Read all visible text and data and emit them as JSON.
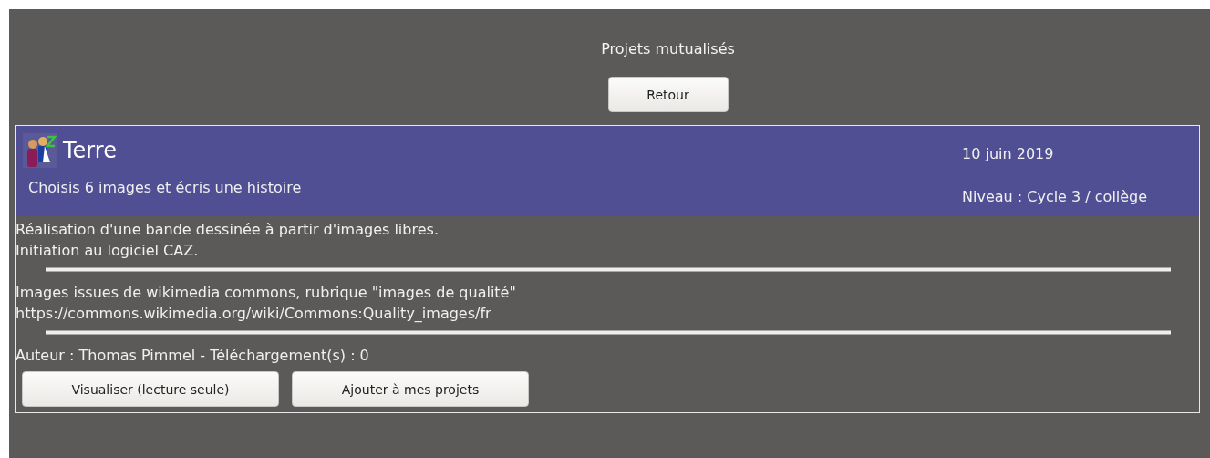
{
  "page": {
    "title": "Projets mutualisés",
    "back_button": "Retour"
  },
  "project": {
    "title": "Terre",
    "subtitle": "Choisis 6 images et écris une histoire",
    "date": "10 juin 2019",
    "level_label": "Niveau : Cycle 3 / collège",
    "sections": [
      {
        "lines": [
          "Réalisation d'une bande dessinée à partir d'images libres.",
          "Initiation au logiciel CAZ."
        ]
      },
      {
        "lines": [
          "Images issues de wikimedia commons, rubrique \"images de qualité\"",
          "https://commons.wikimedia.org/wiki/Commons:Quality_images/fr"
        ]
      }
    ],
    "meta": "Auteur : Thomas Pimmel - Téléchargement(s) : 0",
    "buttons": [
      "Visualiser (lecture seule)",
      "Ajouter à mes projets"
    ]
  }
}
